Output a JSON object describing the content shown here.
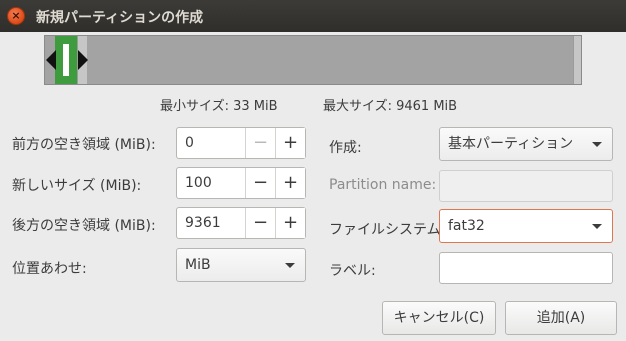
{
  "window": {
    "title": "新規パーティションの作成",
    "close_icon": "×"
  },
  "resizer": {
    "partition_color": "#3e9b3e",
    "min_size_text": "最小サイズ: 33 MiB",
    "max_size_text": "最大サイズ: 9461 MiB"
  },
  "left_form": {
    "free_before": {
      "label": "前方の空き領域 (MiB):",
      "value": "0",
      "minus": "−",
      "plus": "+"
    },
    "new_size": {
      "label": "新しいサイズ (MiB):",
      "value": "100",
      "minus": "−",
      "plus": "+"
    },
    "free_after": {
      "label": "後方の空き領域 (MiB):",
      "value": "9361",
      "minus": "−",
      "plus": "+"
    },
    "align": {
      "label": "位置あわせ:",
      "value": "MiB"
    }
  },
  "right_form": {
    "create_as": {
      "label": "作成:",
      "value": "基本パーティション"
    },
    "partition_name": {
      "label": "Partition name:",
      "value": ""
    },
    "filesystem": {
      "label": "ファイルシステム:",
      "value": "fat32"
    },
    "fs_label": {
      "label": "ラベル:",
      "value": ""
    }
  },
  "buttons": {
    "cancel": "キャンセル(C)",
    "add": "追加(A)"
  }
}
